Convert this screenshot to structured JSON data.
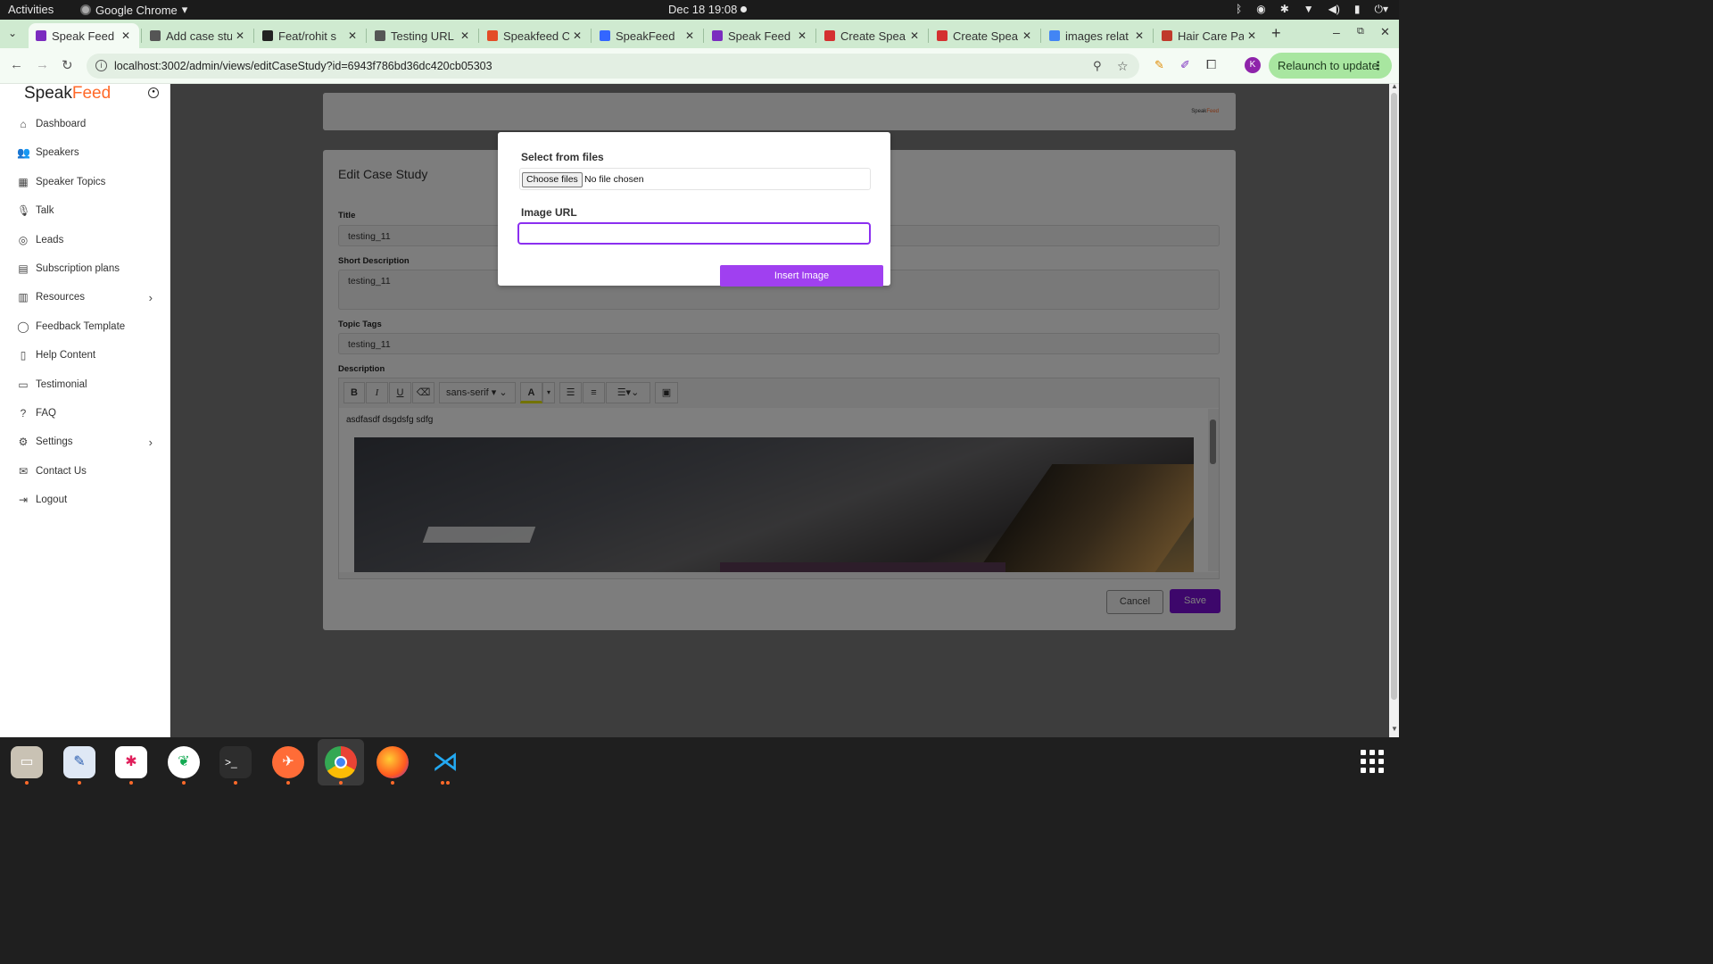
{
  "system": {
    "activities": "Activities",
    "app_name": "Google Chrome",
    "clock": "Dec 18  19:08"
  },
  "browser": {
    "tabs": [
      {
        "title": "Speak Feed",
        "color": "#7b2cbf"
      },
      {
        "title": "Add case stu",
        "color": "#555555"
      },
      {
        "title": "Feat/rohit s",
        "color": "#222222"
      },
      {
        "title": "Testing URL",
        "color": "#555555"
      },
      {
        "title": "Speakfeed C",
        "color": "#e34c26"
      },
      {
        "title": "SpeakFeed",
        "color": "#3366ff"
      },
      {
        "title": "Speak Feed",
        "color": "#7b2cbf"
      },
      {
        "title": "Create Spea",
        "color": "#d43030"
      },
      {
        "title": "Create Spea",
        "color": "#d43030"
      },
      {
        "title": "images relat",
        "color": "#4285f4"
      },
      {
        "title": "Hair Care Pa",
        "color": "#c0392b"
      }
    ],
    "url": "localhost:3002/admin/views/editCaseStudy?id=6943f786bd36dc420cb05303",
    "relaunch_label": "Relaunch to update",
    "profile_initial": "K"
  },
  "sidebar": {
    "logo": "SpeakFeed",
    "items": [
      {
        "label": "Dashboard",
        "icon": "home-icon",
        "glyph": "⌂"
      },
      {
        "label": "Speakers",
        "icon": "users-icon",
        "glyph": "👥"
      },
      {
        "label": "Speaker Topics",
        "icon": "presentation-icon",
        "glyph": "▦"
      },
      {
        "label": "Talk",
        "icon": "microphone-icon",
        "glyph": "🎙"
      },
      {
        "label": "Leads",
        "icon": "target-icon",
        "glyph": "◎"
      },
      {
        "label": "Subscription plans",
        "icon": "document-icon",
        "glyph": "▤"
      },
      {
        "label": "Resources",
        "icon": "book-icon",
        "glyph": "▥",
        "has_children": true
      },
      {
        "label": "Feedback Template",
        "icon": "chat-bubble-icon",
        "glyph": "◯"
      },
      {
        "label": "Help Content",
        "icon": "file-icon",
        "glyph": "▯"
      },
      {
        "label": "Testimonial",
        "icon": "message-square-icon",
        "glyph": "▭"
      },
      {
        "label": "FAQ",
        "icon": "help-circle-icon",
        "glyph": "?"
      },
      {
        "label": "Settings",
        "icon": "gear-icon",
        "glyph": "⚙",
        "has_children": true
      },
      {
        "label": "Contact Us",
        "icon": "mail-icon",
        "glyph": "✉"
      },
      {
        "label": "Logout",
        "icon": "logout-icon",
        "glyph": "⇥"
      }
    ]
  },
  "form": {
    "heading": "Edit Case Study",
    "title_label": "Title",
    "title_value": "testing_11",
    "short_desc_label": "Short Description",
    "short_desc_value": "testing_11",
    "tags_label": "Topic Tags",
    "tags_value": "testing_11",
    "description_label": "Description",
    "font_select": "sans-serif",
    "editor_text": "asdfasdf dsgdsfg sdfg",
    "cancel_label": "Cancel",
    "save_label": "Save",
    "header_brand": "SpeakFeed"
  },
  "modal": {
    "files_label": "Select from files",
    "choose_files": "Choose files",
    "no_file": "No file chosen",
    "url_label": "Image URL",
    "url_value": "",
    "insert_label": "Insert Image"
  },
  "colors": {
    "accent": "#8b2ff0",
    "save": "#7a0fd6",
    "brand_orange": "#ff6a2a"
  }
}
